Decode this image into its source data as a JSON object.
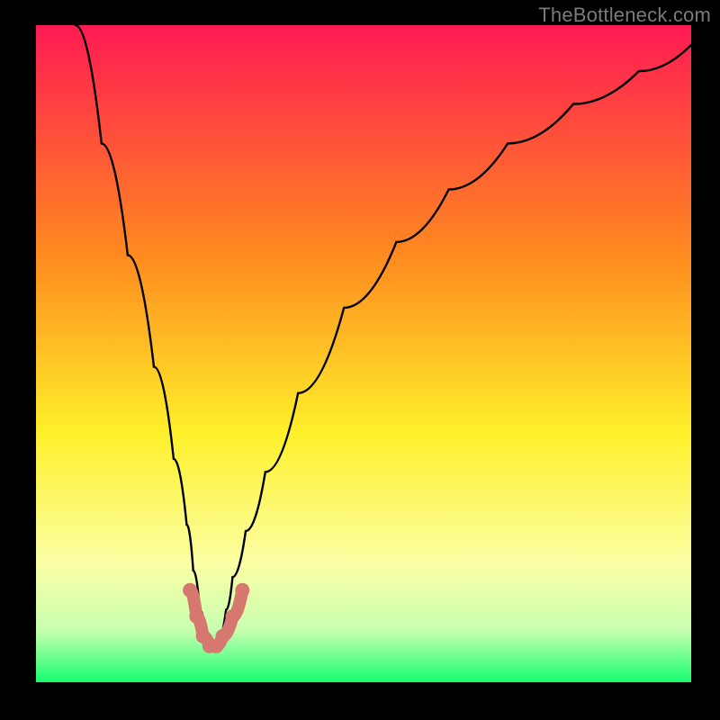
{
  "watermark": "TheBottleneck.com",
  "colors": {
    "frame": "#000000",
    "gradient_top": "#ff1a53",
    "gradient_mid1": "#ff8a1f",
    "gradient_mid2": "#fff02a",
    "gradient_mid3": "#fbffa5",
    "gradient_mid4": "#c9ffb0",
    "gradient_bottom": "#17ff70",
    "curve": "#000000",
    "highlight": "#d6786f"
  },
  "chart_data": {
    "type": "line",
    "title": "",
    "xlabel": "",
    "ylabel": "",
    "xlim": [
      0,
      100
    ],
    "ylim": [
      0,
      100
    ],
    "gradient_colormap": "RdYlGn_r (red high, green low)",
    "series": [
      {
        "name": "bottleneck-v-curve",
        "note": "x,y are approximate pixel-normalized percentages of the plot area; y=100 is top (worst), y=0 is bottom (best). The notch minimum is near x≈27, y≈5.",
        "x": [
          6,
          10,
          14,
          18,
          21,
          23,
          24,
          25,
          26,
          27,
          28,
          29,
          30,
          32,
          35,
          40,
          47,
          55,
          63,
          72,
          82,
          92,
          100
        ],
        "y": [
          100,
          82,
          65,
          48,
          34,
          24,
          17,
          11,
          7,
          5,
          7,
          11,
          16,
          23,
          32,
          44,
          57,
          67,
          75,
          82,
          88,
          93,
          97
        ]
      }
    ],
    "highlight_segment": {
      "note": "thicker salmon-colored segment and endpoint dots near the minimum",
      "x": [
        23.5,
        24.5,
        25.5,
        26.5,
        27.5,
        28.5,
        30.0,
        31.5
      ],
      "y": [
        14,
        10,
        7,
        5.5,
        5.5,
        7,
        10,
        14
      ]
    }
  }
}
